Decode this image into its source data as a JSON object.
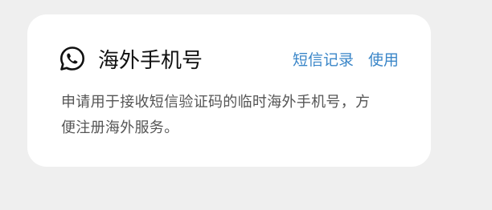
{
  "card": {
    "icon": "whatsapp-icon",
    "title": "海外手机号",
    "links": {
      "sms_records": "短信记录",
      "use": "使用"
    },
    "description": "申请用于接收短信验证码的临时海外手机号，方便注册海外服务。"
  },
  "colors": {
    "background": "#efefef",
    "card": "#ffffff",
    "link": "#3a86c8",
    "title": "#111111",
    "description": "#555555"
  }
}
